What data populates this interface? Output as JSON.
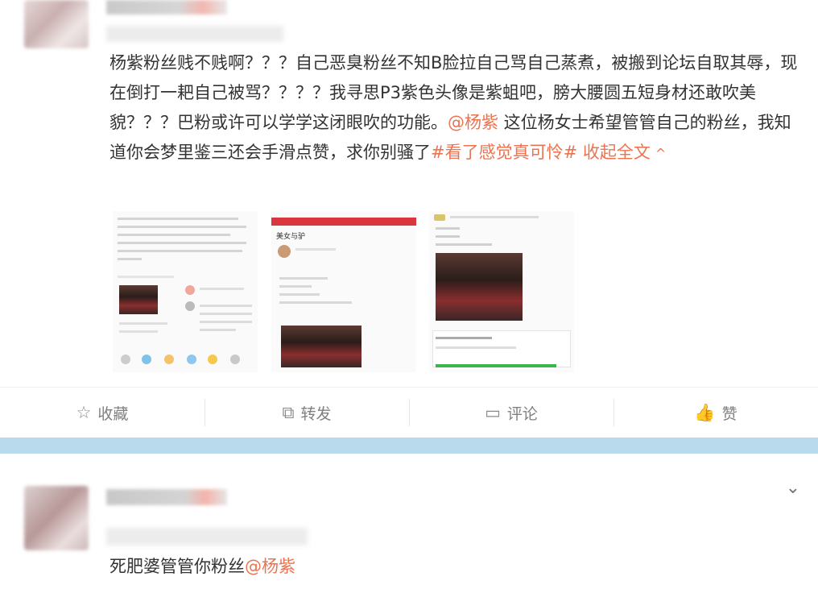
{
  "post": {
    "text_before_mention": "杨紫粉丝贱不贱啊？？？自己恶臭粉丝不知B脸拉自己骂自己蒸煮，被搬到论坛自取其辱，现在倒打一耙自己被骂？？？？我寻思P3紫色头像是紫蛆吧，膀大腰圆五短身材还敢吹美貌？？？巴粉或许可以学学这闭眼吹的功能。",
    "mention": "@杨紫",
    "text_after_mention": " 这位杨女士希望管管自己的粉丝，我知道你会梦里鉴三还会手滑点赞，求你别骚了",
    "hashtag": "#看了感觉真可怜#",
    "collapse_label": "收起全文",
    "collapse_icon": "^",
    "images": [
      {
        "name": "screenshot-1"
      },
      {
        "name": "screenshot-2",
        "title": "美女与驴"
      },
      {
        "name": "screenshot-3"
      }
    ]
  },
  "actions": [
    {
      "name": "favorite",
      "icon": "☆",
      "label": "收藏"
    },
    {
      "name": "repost",
      "icon": "⧉",
      "label": "转发"
    },
    {
      "name": "comment",
      "icon": "▭",
      "label": "评论"
    },
    {
      "name": "like",
      "icon": "👍",
      "label": "赞"
    }
  ],
  "comment": {
    "text": "死肥婆管管你粉丝",
    "mention": "@杨紫",
    "chevron_icon": "⌄"
  },
  "colors": {
    "accent": "#eb7350",
    "divider": "#b9d9ec",
    "text": "#333333",
    "muted": "#808080"
  }
}
